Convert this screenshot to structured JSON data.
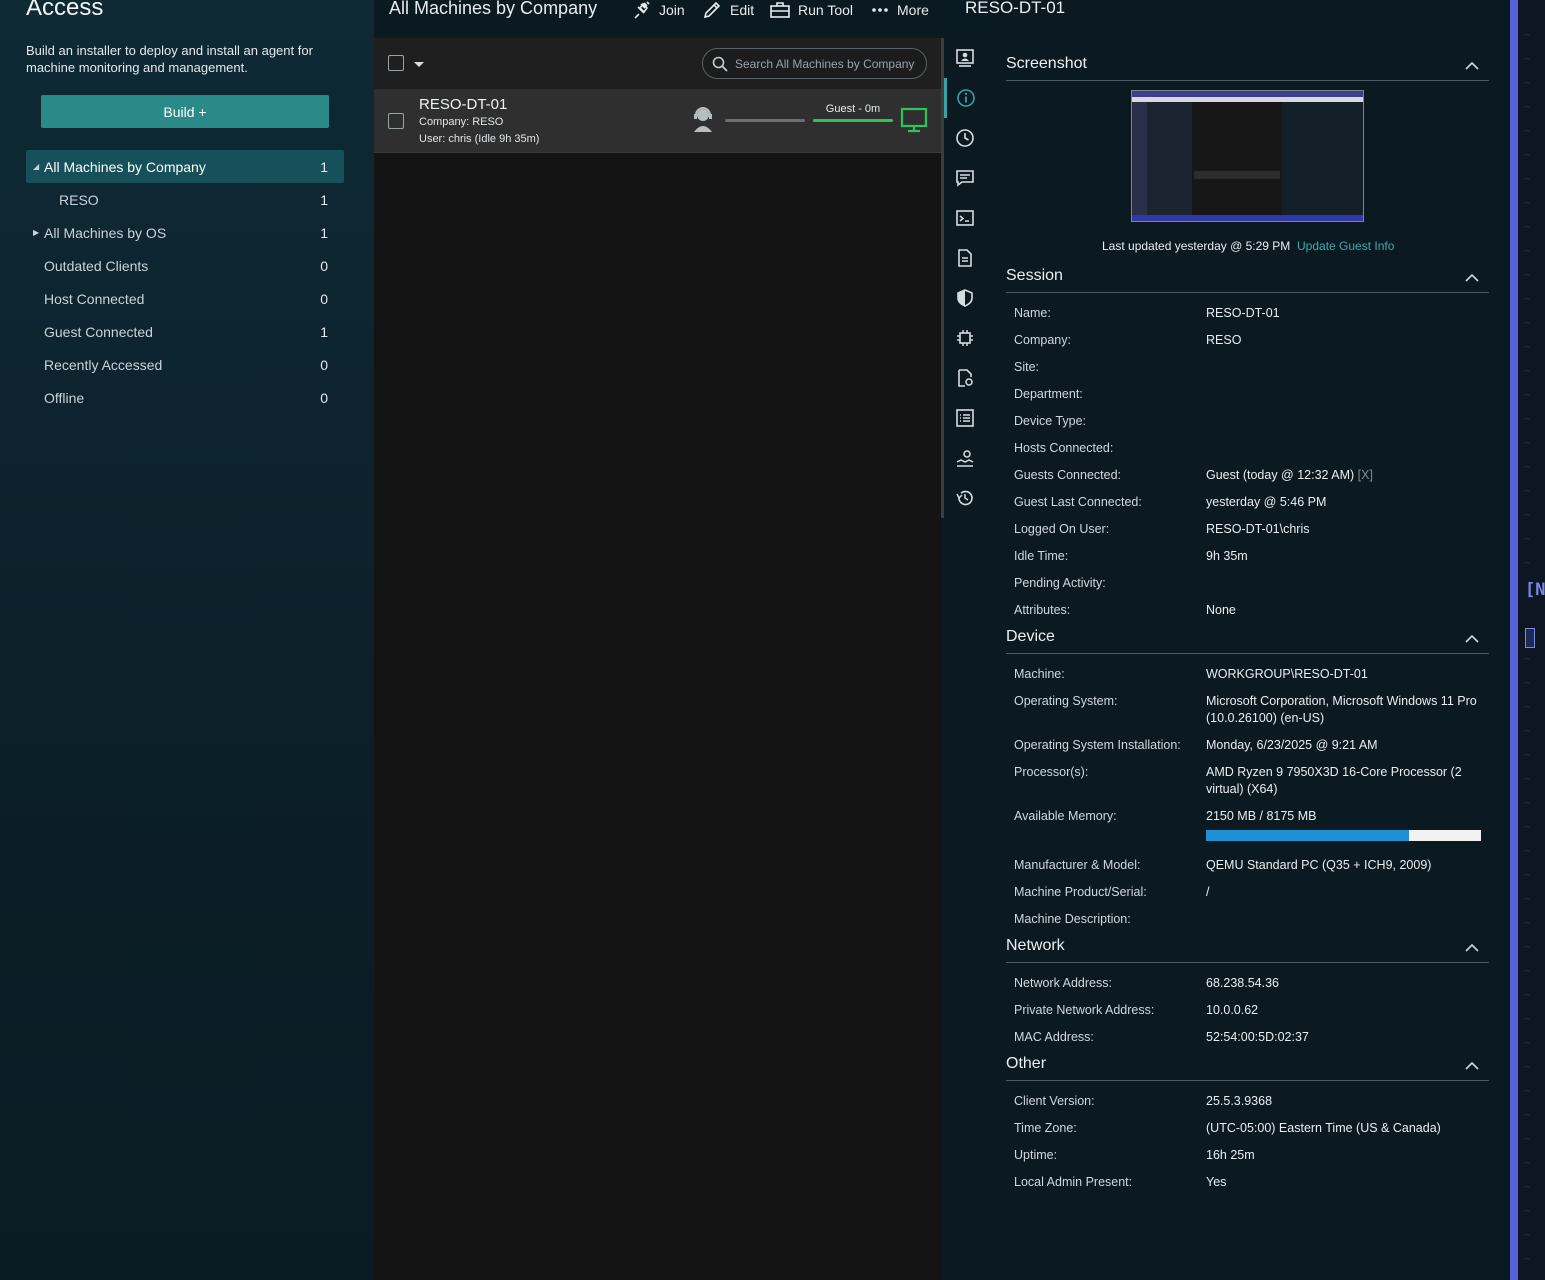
{
  "sidebar": {
    "title": "Access",
    "description": "Build an installer to deploy and install an agent for machine monitoring and management.",
    "build_label": "Build +",
    "items": [
      {
        "label": "All Machines by Company",
        "count": "1"
      },
      {
        "label": "RESO",
        "count": "1"
      },
      {
        "label": "All Machines by OS",
        "count": "1"
      },
      {
        "label": "Outdated Clients",
        "count": "0"
      },
      {
        "label": "Host Connected",
        "count": "0"
      },
      {
        "label": "Guest Connected",
        "count": "1"
      },
      {
        "label": "Recently Accessed",
        "count": "0"
      },
      {
        "label": "Offline",
        "count": "0"
      }
    ]
  },
  "list": {
    "title": "All Machines by Company",
    "toolbar": {
      "join": "Join",
      "edit": "Edit",
      "run_tool": "Run Tool",
      "more": "More"
    },
    "search_placeholder": "Search All Machines by Company",
    "session": {
      "name": "RESO-DT-01",
      "company": "Company: RESO",
      "user": "User: chris (Idle 9h 35m)",
      "guest_status": "Guest - 0m"
    }
  },
  "details": {
    "title": "RESO-DT-01",
    "screenshot": {
      "heading": "Screenshot",
      "note": "Last updated yesterday @ 5:29 PM",
      "link": "Update Guest Info"
    },
    "session": {
      "heading": "Session",
      "name_l": "Name:",
      "name_v": "RESO-DT-01",
      "company_l": "Company:",
      "company_v": "RESO",
      "site_l": "Site:",
      "dept_l": "Department:",
      "devtype_l": "Device Type:",
      "hosts_l": "Hosts Connected:",
      "guests_l": "Guests Connected:",
      "guests_v": "Guest (today @ 12:32 AM)",
      "guests_x": "[X]",
      "glast_l": "Guest Last Connected:",
      "glast_v": "yesterday @ 5:46 PM",
      "user_l": "Logged On User:",
      "user_v": "RESO-DT-01\\chris",
      "idle_l": "Idle Time:",
      "idle_v": "9h 35m",
      "pending_l": "Pending Activity:",
      "attr_l": "Attributes:",
      "attr_v": "None"
    },
    "device": {
      "heading": "Device",
      "machine_l": "Machine:",
      "machine_v": "WORKGROUP\\RESO-DT-01",
      "os_l": "Operating System:",
      "os_v": "Microsoft Corporation, Microsoft Windows 11 Pro (10.0.26100) (en-US)",
      "osinst_l": "Operating System Installation:",
      "osinst_v": "Monday, 6/23/2025 @ 9:21 AM",
      "cpu_l": "Processor(s):",
      "cpu_v": "AMD Ryzen 9 7950X3D 16-Core Processor (2 virtual) (X64)",
      "mem_l": "Available Memory:",
      "mem_v": "2150 MB / 8175 MB",
      "mem_fraction": 0.737,
      "mfr_l": "Manufacturer & Model:",
      "mfr_v": "QEMU Standard PC (Q35 + ICH9, 2009)",
      "serial_l": "Machine Product/Serial:",
      "serial_v": "/",
      "desc_l": "Machine Description:"
    },
    "network": {
      "heading": "Network",
      "addr_l": "Network Address:",
      "addr_v": "68.238.54.36",
      "priv_l": "Private Network Address:",
      "priv_v": "10.0.0.62",
      "mac_l": "MAC Address:",
      "mac_v": "52:54:00:5D:02:37"
    },
    "other": {
      "heading": "Other",
      "ver_l": "Client Version:",
      "ver_v": "25.5.3.9368",
      "tz_l": "Time Zone:",
      "tz_v": "(UTC-05:00) Eastern Time (US & Canada)",
      "up_l": "Uptime:",
      "up_v": "16h 25m",
      "admin_l": "Local Admin Present:",
      "admin_v": "Yes"
    }
  },
  "edge_text": "[N",
  "colors": {
    "accent": "#2a8a87",
    "guest_green": "#2fc45a",
    "memory_blue": "#1f8fd6",
    "link": "#3fa9ae"
  }
}
